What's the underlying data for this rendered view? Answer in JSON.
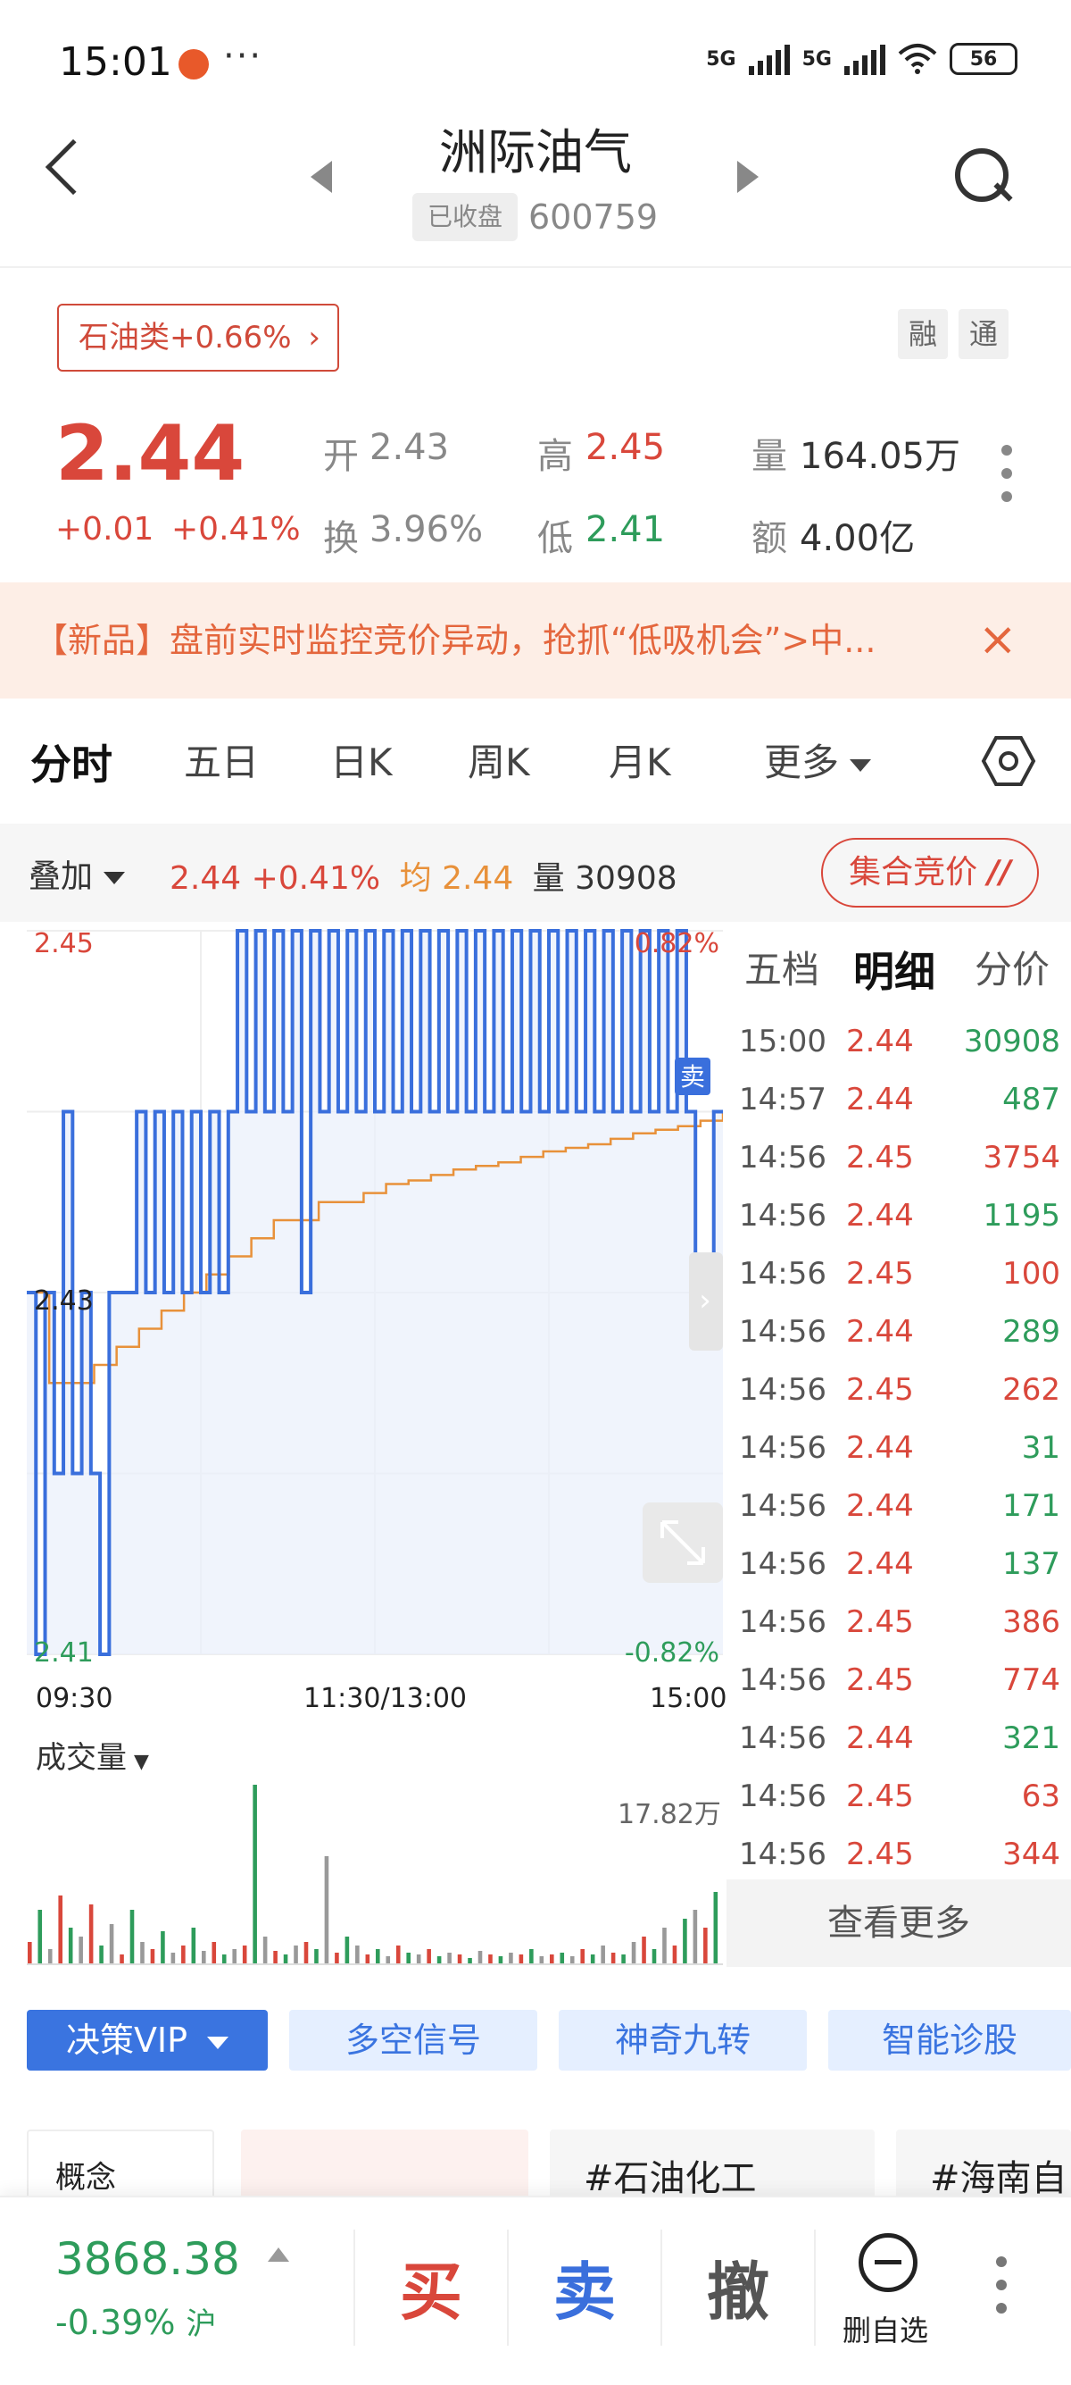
{
  "status_bar": {
    "time": "15:01",
    "more": "···",
    "net1": "5G",
    "net2": "5G",
    "battery": "56"
  },
  "header": {
    "title": "洲际油气",
    "status": "已收盘",
    "code": "600759"
  },
  "sector": {
    "label": "石油类+0.66%",
    "chevron": "›"
  },
  "badges": [
    "融",
    "通"
  ],
  "quote": {
    "price": "2.44",
    "change": "+0.01",
    "change_pct": "+0.41%",
    "open_label": "开",
    "open": "2.43",
    "high_label": "高",
    "high": "2.45",
    "volume_label": "量",
    "volume": "164.05万",
    "turnover_label": "换",
    "turnover": "3.96%",
    "low_label": "低",
    "low": "2.41",
    "amount_label": "额",
    "amount": "4.00亿"
  },
  "banner": {
    "text": "【新品】盘前实时监控竞价异动，抢抓“低吸机会”>中...",
    "close": "×"
  },
  "tabs": [
    "分时",
    "五日",
    "日K",
    "周K",
    "月K",
    "更多"
  ],
  "overlay": {
    "label": "叠加",
    "price": "2.44",
    "pct": "+0.41%",
    "avg_label": "均",
    "avg": "2.44",
    "vol_label": "量",
    "vol": "30908",
    "auction": "集合竞价"
  },
  "chart_labels": {
    "y_top": "2.45",
    "y_mid": "2.43",
    "y_bottom": "2.41",
    "pct_top": "0.82%",
    "pct_bottom": "-0.82%",
    "sell_marker": "卖",
    "volume_title": "成交量",
    "volume_max": "17.82万"
  },
  "chart_data": {
    "type": "line",
    "x_ticks": [
      "09:30",
      "11:30/13:00",
      "15:00"
    ],
    "ylim": [
      2.41,
      2.45
    ],
    "series": [
      {
        "values": [
          2.43,
          2.41,
          2.43,
          2.42,
          2.44,
          2.42,
          2.43,
          2.42,
          2.41,
          2.43,
          2.43,
          2.43,
          2.44,
          2.43,
          2.44,
          2.43,
          2.44,
          2.43,
          2.44,
          2.43,
          2.44,
          2.43,
          2.44,
          2.45,
          2.44,
          2.45,
          2.44,
          2.45,
          2.44,
          2.45,
          2.43,
          2.45,
          2.44,
          2.45,
          2.44,
          2.45,
          2.44,
          2.45,
          2.44,
          2.45,
          2.44,
          2.45,
          2.44,
          2.45,
          2.44,
          2.45,
          2.44,
          2.45,
          2.44,
          2.45,
          2.44,
          2.45,
          2.44,
          2.45,
          2.44,
          2.45,
          2.44,
          2.45,
          2.44,
          2.45,
          2.44,
          2.45,
          2.44,
          2.45,
          2.44,
          2.45,
          2.44,
          2.45,
          2.44,
          2.45,
          2.44,
          2.45,
          2.44,
          2.43,
          2.43,
          2.44,
          2.44
        ]
      },
      {
        "values": [
          2.43,
          2.425,
          2.425,
          2.426,
          2.427,
          2.428,
          2.429,
          2.43,
          2.431,
          2.432,
          2.433,
          2.434,
          2.434,
          2.435,
          2.435,
          2.4355,
          2.436,
          2.4362,
          2.4365,
          2.4368,
          2.437,
          2.4372,
          2.4375,
          2.4378,
          2.438,
          2.4382,
          2.4385,
          2.4388,
          2.439,
          2.4392,
          2.4395,
          2.44
        ]
      }
    ]
  },
  "volume_bars": [
    0.12,
    0.3,
    0.08,
    0.38,
    0.2,
    0.15,
    0.33,
    0.1,
    0.22,
    0.05,
    0.3,
    0.12,
    0.08,
    0.18,
    0.06,
    0.1,
    0.2,
    0.07,
    0.12,
    0.05,
    0.08,
    0.1,
    1.0,
    0.15,
    0.07,
    0.05,
    0.1,
    0.12,
    0.08,
    0.6,
    0.06,
    0.15,
    0.1,
    0.05,
    0.08,
    0.04,
    0.1,
    0.06,
    0.05,
    0.08,
    0.04,
    0.06,
    0.05,
    0.03,
    0.07,
    0.05,
    0.04,
    0.06,
    0.05,
    0.08,
    0.04,
    0.05,
    0.06,
    0.04,
    0.08,
    0.05,
    0.1,
    0.06,
    0.05,
    0.12,
    0.15,
    0.08,
    0.2,
    0.1,
    0.25,
    0.3,
    0.2,
    0.4
  ],
  "detail_tabs": [
    "五档",
    "明细",
    "分价"
  ],
  "ticks": [
    {
      "t": "15:00",
      "p": "2.44",
      "v": "30908",
      "c": "green"
    },
    {
      "t": "14:57",
      "p": "2.44",
      "v": "487",
      "c": "green"
    },
    {
      "t": "14:56",
      "p": "2.45",
      "v": "3754",
      "c": "red"
    },
    {
      "t": "14:56",
      "p": "2.44",
      "v": "1195",
      "c": "green"
    },
    {
      "t": "14:56",
      "p": "2.45",
      "v": "100",
      "c": "red"
    },
    {
      "t": "14:56",
      "p": "2.44",
      "v": "289",
      "c": "green"
    },
    {
      "t": "14:56",
      "p": "2.45",
      "v": "262",
      "c": "red"
    },
    {
      "t": "14:56",
      "p": "2.44",
      "v": "31",
      "c": "green"
    },
    {
      "t": "14:56",
      "p": "2.44",
      "v": "171",
      "c": "green"
    },
    {
      "t": "14:56",
      "p": "2.44",
      "v": "137",
      "c": "green"
    },
    {
      "t": "14:56",
      "p": "2.45",
      "v": "386",
      "c": "red"
    },
    {
      "t": "14:56",
      "p": "2.45",
      "v": "774",
      "c": "red"
    },
    {
      "t": "14:56",
      "p": "2.44",
      "v": "321",
      "c": "green"
    },
    {
      "t": "14:56",
      "p": "2.45",
      "v": "63",
      "c": "red"
    },
    {
      "t": "14:56",
      "p": "2.45",
      "v": "344",
      "c": "red"
    }
  ],
  "see_more": "查看更多",
  "features": [
    "决策VIP",
    "多空信号",
    "神奇九转",
    "智能诊股"
  ],
  "concepts": {
    "label": "概念",
    "items": [
      "#石油化工",
      "#海南自"
    ]
  },
  "bottom": {
    "index_value": "3868.38",
    "index_change": "-0.39%",
    "index_market": "沪",
    "buy": "买",
    "sell": "卖",
    "cancel": "撤",
    "remove": "删自选"
  },
  "colors": {
    "up": "#d9473b",
    "down": "#2e9c5b",
    "price_line": "#3a6fdc",
    "avg_line": "#e8913a",
    "accent": "#3a74e0"
  }
}
